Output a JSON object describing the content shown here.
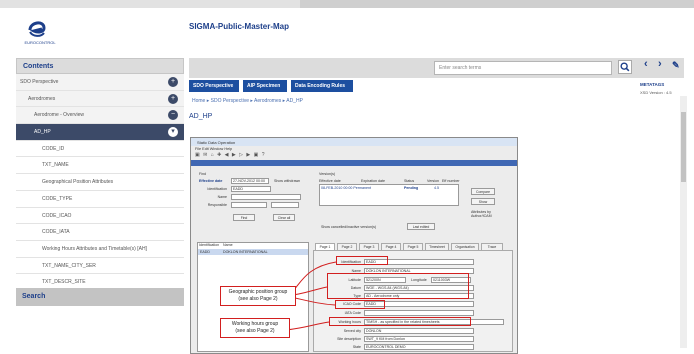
{
  "app": {
    "title": "SIGMA-Public-Master-Map",
    "logo_text": "EUROCONTROL"
  },
  "sidebar": {
    "heading": "Contents",
    "items": [
      {
        "label": "SDO Perspective",
        "state": "plus"
      },
      {
        "label": "Aerodromes",
        "state": "plus"
      },
      {
        "label": "Aerodrome - Overview",
        "state": "minus"
      },
      {
        "label": "AD_HP",
        "state": "selected"
      },
      {
        "label": "CODE_ID",
        "state": "leaf"
      },
      {
        "label": "TXT_NAME",
        "state": "leaf"
      },
      {
        "label": "Geographical Position Attributes",
        "state": "leaf"
      },
      {
        "label": "CODE_TYPE",
        "state": "leaf"
      },
      {
        "label": "CODE_ICAO",
        "state": "leaf"
      },
      {
        "label": "CODE_IATA",
        "state": "leaf"
      },
      {
        "label": "Working Hours Attributes and Timetable(s) [AH]",
        "state": "leaf"
      },
      {
        "label": "TXT_NAME_CITY_SER",
        "state": "leaf"
      },
      {
        "label": "TXT_DESCR_SITE",
        "state": "leaf"
      }
    ],
    "search_heading": "Search"
  },
  "topbar": {
    "search_placeholder": "Enter search terms",
    "metatags": "METATAGS",
    "xsd_version": "XSD Version : 4.5"
  },
  "buttons": {
    "sdo": "SDO Perspective",
    "aip": "AIP Specimen",
    "rules": "Data Encoding Rules"
  },
  "breadcrumb": "Home   ▸   SDO Perspective   ▸   Aerodromes   ▸   AD_HP",
  "page_heading": "AD_HP",
  "editor": {
    "window_title": "Static Data Operation",
    "menu": "File  Edit  Window  Help",
    "find_label": "Find",
    "effective_date_label": "Effective date",
    "effective_date": "27-NOV-2012 00:00",
    "show_withdrawn": "Show withdrawn",
    "identification_label": "Identification",
    "identification": "EADD",
    "name_label": "Name",
    "responsible_label": "Responsible",
    "find_btn": "Find",
    "clearall_btn": "Clear all",
    "versions_label": "Version(s)",
    "col_eff": "Effective date",
    "col_exp": "Expiration date",
    "col_status": "Status",
    "col_version": "Version",
    "col_effnum": "Eff number",
    "version_row": "08-FEB-2010 00:00   Permanent",
    "version_status": "Pending",
    "version_num": "4.5",
    "compare_btn": "Compare",
    "show_btn": "Show",
    "attributes_lbl": "Attributes by Author/ICAM",
    "show_cancelled": "Show cancelled/inactive version(s)",
    "last_edited": "Last edited",
    "list_ident": "Identification",
    "list_name": "Name",
    "list_row_id": "EADD",
    "list_row_name": "DOKLON INTERNATIONAL",
    "tabs": [
      "Page 1",
      "Page 2",
      "Page 3",
      "Page 4",
      "Page 5",
      "Timesheet",
      "Organisation",
      "Trace"
    ],
    "fields": [
      {
        "label": "Identification",
        "value": "EADD"
      },
      {
        "label": "Name",
        "value": "DOKLON INTERNATIONAL"
      },
      {
        "label": "Latitude",
        "value": "521200N",
        "extra_label": "Longitude",
        "extra": "0211003W"
      },
      {
        "label": "Datum",
        "value": "WGE - WGS-84 (WGS-84)"
      },
      {
        "label": "Type",
        "value": "AD - Aerodrome only"
      },
      {
        "label": "ICAO Code",
        "value": "EADD"
      },
      {
        "label": "IATA Code",
        "value": ""
      },
      {
        "label": "Working hours",
        "value": "TIMSH - as specified in the related timesheets"
      },
      {
        "label": "Served city",
        "value": "DONLON"
      },
      {
        "label": "Site description",
        "value": "SWT_9 KM from Donlon"
      },
      {
        "label": "State",
        "value": "EUROCONTROL DEMO"
      }
    ]
  },
  "callouts": {
    "geo": "Geographic position group\n(see also Page 2)",
    "hours": "Working hours group\n(see also Page 2)"
  },
  "colors": {
    "accent": "#1d4fa0",
    "selected": "#3c4a68",
    "highlight": "#d21f1f"
  }
}
